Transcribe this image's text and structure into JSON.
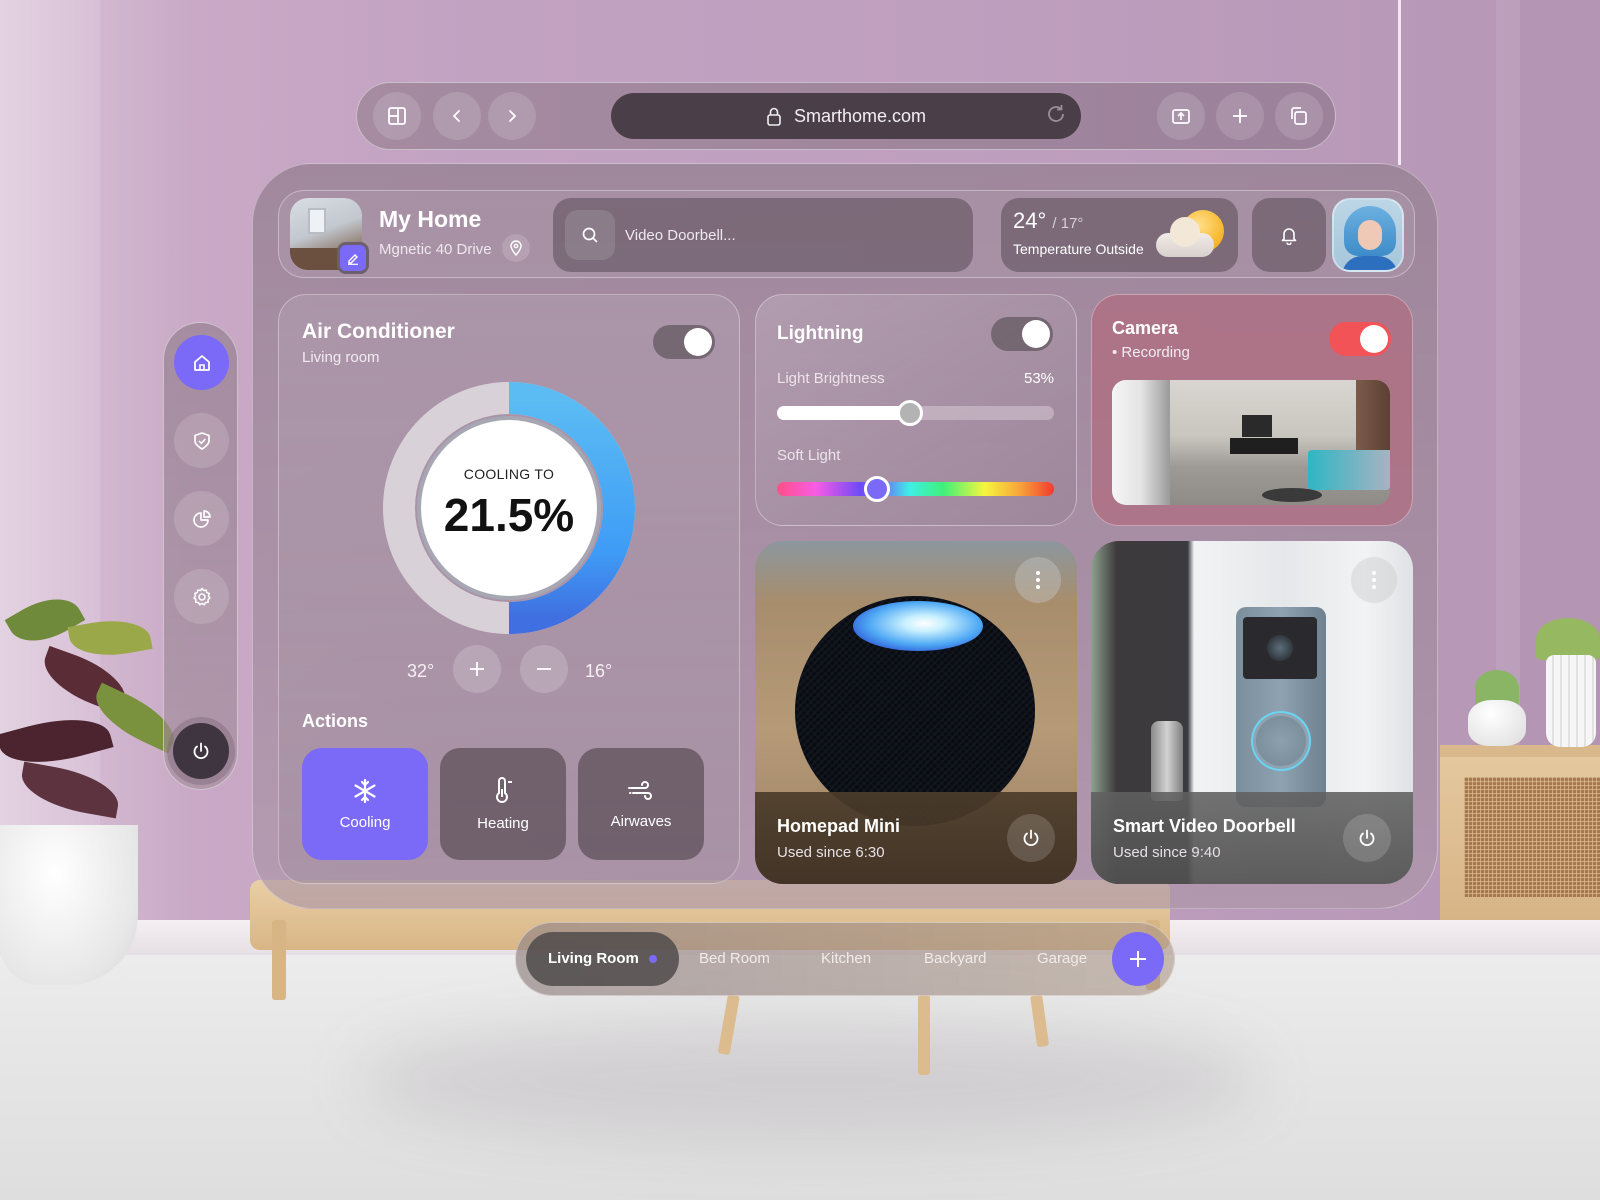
{
  "browser": {
    "url": "Smarthome.com",
    "icons": {
      "sidebar_toggle": "sidebar-layout-icon",
      "back": "chevron-left-icon",
      "forward": "chevron-right-icon",
      "lock": "lock-icon",
      "reload": "reload-icon",
      "share": "share-icon",
      "new_tab": "plus-icon",
      "tabs": "tabs-icon"
    }
  },
  "header": {
    "home_title": "My Home",
    "home_address": "Mgnetic 40 Drive",
    "search": {
      "placeholder": "Video Doorbell..."
    },
    "weather": {
      "high": "24°",
      "low": "/ 17°",
      "label": "Temperature Outside",
      "icon": "partly-cloudy-icon"
    }
  },
  "sidebar": {
    "items": [
      {
        "id": "home",
        "icon": "home-icon",
        "active": true
      },
      {
        "id": "security",
        "icon": "shield-check-icon",
        "active": false
      },
      {
        "id": "stats",
        "icon": "pie-chart-icon",
        "active": false
      },
      {
        "id": "settings",
        "icon": "gear-icon",
        "active": false
      },
      {
        "id": "power",
        "icon": "power-icon",
        "active": false
      }
    ]
  },
  "air_conditioner": {
    "title": "Air Conditioner",
    "room": "Living room",
    "enabled": true,
    "mode_label": "COOLING TO",
    "value": "21.5%",
    "gauge_fraction": 0.5,
    "range_max": "32°",
    "range_min": "16°",
    "increase_label": "+",
    "decrease_label": "−",
    "actions_title": "Actions",
    "actions": [
      {
        "label": "Cooling",
        "icon": "snowflake-icon",
        "active": true
      },
      {
        "label": "Heating",
        "icon": "thermometer-icon",
        "active": false
      },
      {
        "label": "Airwaves",
        "icon": "wind-icon",
        "active": false
      }
    ]
  },
  "lighting": {
    "title": "Lightning",
    "enabled": true,
    "brightness_label": "Light Brightness",
    "brightness_value": "53%",
    "brightness_fraction": 0.48,
    "soft_light_label": "Soft Light",
    "soft_light_fraction": 0.36,
    "soft_light_color": "#7a6af7"
  },
  "camera": {
    "title": "Camera",
    "status": "• Recording",
    "enabled": true,
    "toggle_color": "#f15357"
  },
  "devices": [
    {
      "name": "Homepad Mini",
      "since": "Used since 6:30"
    },
    {
      "name": "Smart Video Doorbell",
      "since": "Used since 9:40"
    }
  ],
  "rooms": {
    "tabs": [
      "Living Room",
      "Bed Room",
      "Kitchen",
      "Backyard",
      "Garage"
    ],
    "active_index": 0,
    "add_label": "+"
  },
  "colors": {
    "accent": "#7a6af7",
    "gauge_start": "#5bbcf3",
    "gauge_end": "#3f6fe0",
    "recording": "#f15357"
  }
}
